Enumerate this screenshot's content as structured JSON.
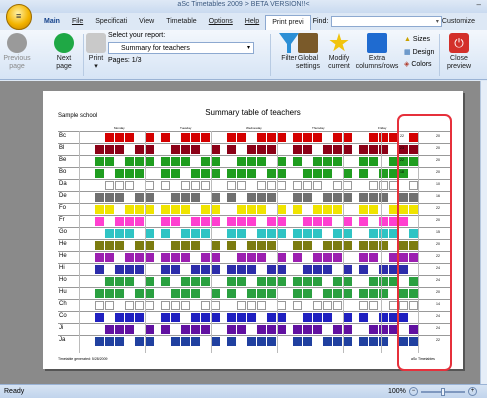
{
  "window": {
    "title": "aSc Timetables 2009 > BETA VERSION!!<",
    "minimize": "–"
  },
  "app_button": {
    "icon": "app-orb-icon"
  },
  "menu": {
    "main": "Main",
    "file": "File",
    "specification": "Specificati",
    "view": "View",
    "timetable": "Timetable",
    "options": "Options",
    "help": "Help",
    "print_preview": "Print previ",
    "find_label": "Find:",
    "find_value": "",
    "customize": "Customize"
  },
  "ribbon": {
    "previous": {
      "l1": "Previous",
      "l2": "page"
    },
    "next": {
      "l1": "Next",
      "l2": "page"
    },
    "print": {
      "l1": "Print",
      "l2": "▾"
    },
    "select_label": "Select your report:",
    "report_value": "Summary for teachers",
    "pages": "Pages: 1/3",
    "filter": "Filter",
    "global": {
      "l1": "Global",
      "l2": "settings"
    },
    "modify": {
      "l1": "Modify",
      "l2": "current"
    },
    "extra": {
      "l1": "Extra",
      "l2": "columns/rows"
    },
    "sizes": "Sizes",
    "design": "Design",
    "colors": "Colors",
    "close": {
      "l1": "Close",
      "l2": "preview"
    }
  },
  "preview": {
    "title": "Summary table of teachers",
    "school": "Sample school",
    "days": [
      "Monday",
      "Tuesday",
      "Wednesday",
      "Thursday",
      "Friday"
    ],
    "generated": "Timetable generated: 5/28/2009",
    "brand": "aSc Timetables",
    "teachers": [
      {
        "name": "Bc",
        "s1": "22",
        "s2": "20",
        "color": "#d40000"
      },
      {
        "name": "Bl",
        "s1": "23",
        "s2": "20",
        "color": "#8b0016"
      },
      {
        "name": "Be",
        "s1": "22",
        "s2": "20",
        "color": "#1f9d1f"
      },
      {
        "name": "Bo",
        "s1": "18",
        "s2": "20",
        "color": "#1f9d1f"
      },
      {
        "name": "Da",
        "s1": "",
        "s2": "10",
        "color": "#ffffff"
      },
      {
        "name": "De",
        "s1": "",
        "s2": "16",
        "color": "#707070"
      },
      {
        "name": "Fo",
        "s1": "",
        "s2": "22",
        "color": "#f0e400"
      },
      {
        "name": "Fr",
        "s1": "",
        "s2": "20",
        "color": "#ff3fd0"
      },
      {
        "name": "Go",
        "s1": "",
        "s2": "15",
        "color": "#2fc4c4"
      },
      {
        "name": "He",
        "s1": "",
        "s2": "20",
        "color": "#7c7c10"
      },
      {
        "name": "He",
        "s1": "",
        "s2": "22",
        "color": "#9b1fb0"
      },
      {
        "name": "Hi",
        "s1": "",
        "s2": "24",
        "color": "#2c2caa"
      },
      {
        "name": "Ho",
        "s1": "",
        "s2": "24",
        "color": "#2aa040"
      },
      {
        "name": "Hu",
        "s1": "",
        "s2": "20",
        "color": "#2aa040"
      },
      {
        "name": "Ch",
        "s1": "",
        "s2": "14",
        "color": "#ffffff"
      },
      {
        "name": "Co",
        "s1": "",
        "s2": "24",
        "color": "#2020c0"
      },
      {
        "name": "Ji",
        "s1": "",
        "s2": "24",
        "color": "#6010a0"
      },
      {
        "name": "Ja",
        "s1": "",
        "s2": "22",
        "color": "#2040a0"
      }
    ]
  },
  "status": {
    "text": "Ready",
    "zoom": "100%",
    "zoom_level": 1.0
  }
}
